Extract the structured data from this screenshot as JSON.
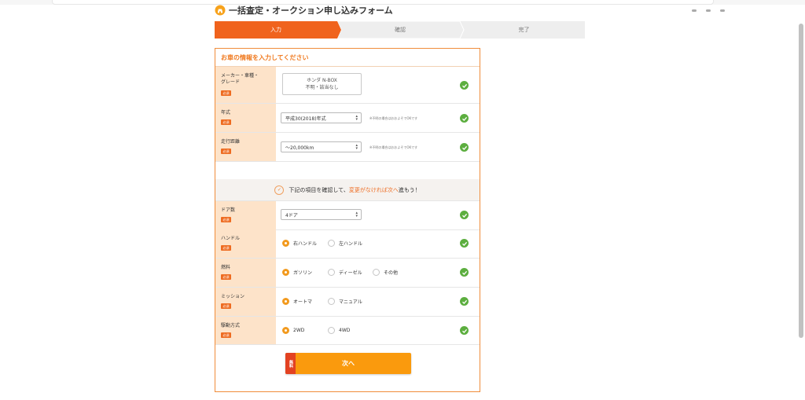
{
  "page_title": "一括査定・オークション申し込みフォーム",
  "steps": [
    {
      "label": "入力",
      "active": true
    },
    {
      "label": "確認",
      "active": false
    },
    {
      "label": "完了",
      "active": false
    }
  ],
  "section_title": "お車の情報を入力してください",
  "required_badge": "必須",
  "fields": {
    "maker": {
      "label_lines": [
        "メーカー・車種・",
        "グレード"
      ],
      "value_line1": "ホンダ N-BOX",
      "value_line2": "不明・該当なし"
    },
    "year": {
      "label": "年式",
      "value": "平成30(2018)年式",
      "note": "※不明の場合はおおよそでOKです"
    },
    "mileage": {
      "label": "走行距離",
      "value": "〜20,000km",
      "note": "※不明の場合はおおよそでOKです"
    }
  },
  "confirm_banner": {
    "prefix": "下記の項目を確認して、",
    "highlight": "変更がなければ次へ",
    "suffix": "進もう！"
  },
  "doors": {
    "label": "ドア数",
    "value": "4ドア"
  },
  "handle": {
    "label": "ハンドル",
    "options": [
      "右ハンドル",
      "左ハンドル"
    ],
    "selected": 0
  },
  "fuel": {
    "label": "燃料",
    "options": [
      "ガソリン",
      "ディーゼル",
      "その他"
    ],
    "selected": 0
  },
  "mission": {
    "label": "ミッション",
    "options": [
      "オートマ",
      "マニュアル"
    ],
    "selected": 0
  },
  "drive": {
    "label": "駆動方式",
    "options": [
      "2WD",
      "4WD"
    ],
    "selected": 0
  },
  "next_button": {
    "label": "次へ",
    "free_tag": "無料"
  },
  "colors": {
    "accent": "#ee6b20",
    "step_active": "#f0631d",
    "check_green": "#5cae3f",
    "button": "#fa9a0d"
  }
}
